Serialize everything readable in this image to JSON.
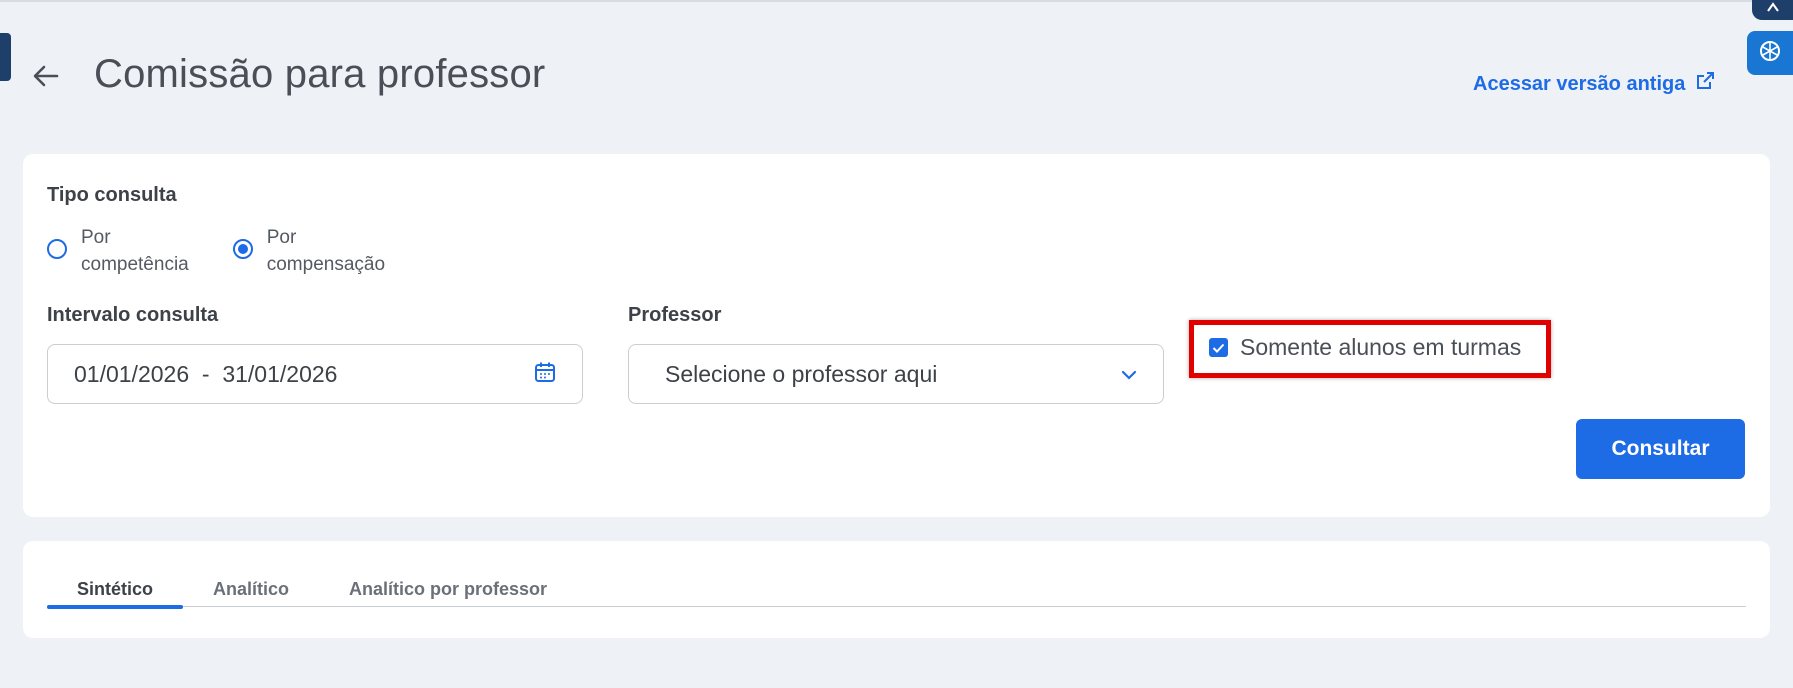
{
  "header": {
    "title": "Comissão para professor",
    "old_version_link": "Acessar versão antiga"
  },
  "filters": {
    "query_type_label": "Tipo consulta",
    "query_type_options": [
      {
        "label": "Por\ncompetência",
        "selected": false
      },
      {
        "label": "Por\ncompensação",
        "selected": true
      }
    ],
    "interval_label": "Intervalo consulta",
    "date_range": "01/01/2026  -  31/01/2026",
    "professor_label": "Professor",
    "professor_placeholder": "Selecione o professor aqui",
    "only_students_in_classes": {
      "label": "Somente alunos em turmas",
      "checked": true
    },
    "submit_label": "Consultar"
  },
  "tabs": [
    {
      "label": "Sintético",
      "active": true
    },
    {
      "label": "Analítico",
      "active": false
    },
    {
      "label": "Analítico por professor",
      "active": false
    }
  ],
  "colors": {
    "primary": "#1e6be6",
    "background": "#eef1f6",
    "highlight": "#e00000",
    "sidebar_dark": "#1f3f6b"
  }
}
